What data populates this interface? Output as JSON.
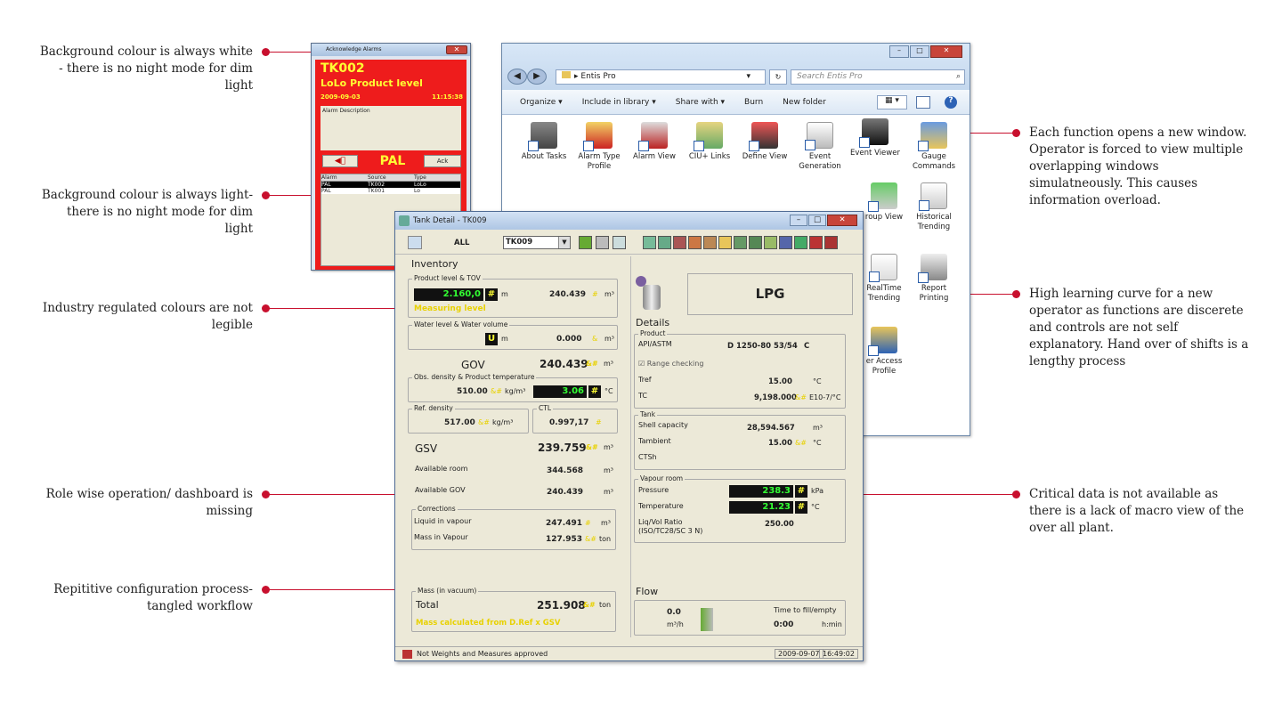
{
  "annotations_left": [
    "Background colour is always white - there is no night mode for dim light",
    "Background colour is always light- there is no night mode for dim light",
    "Industry regulated colours are not legible",
    "Role wise operation/ dashboard is missing",
    "Repititive configuration process- tangled workflow"
  ],
  "annotations_right": [
    "Each function opens a new window. Operator is forced to view multiple overlapping windows simulatneously. This causes information overload.",
    "High learning curve for a new operator as functions are discerete and controls are not self explanatory. Hand over of shifts is a lengthy process",
    "Critical data is not available as there is a lack of macro view of the over all plant."
  ],
  "accent_color": "#c8102e",
  "alarm": {
    "title": "Acknowledge Alarms",
    "tank": "TK002",
    "message": "LoLo Product level",
    "date": "2009-09-03",
    "time": "11:15:38",
    "desc_label": "Alarm Description",
    "pal": "PAL",
    "ack": "Ack",
    "columns": [
      "Alarm",
      "Source",
      "Type"
    ],
    "rows": [
      [
        "PAL",
        "TK002",
        "LoLo"
      ],
      [
        "PAL",
        "TK001",
        "Lo"
      ]
    ]
  },
  "explorer": {
    "path": "Entis Pro",
    "search_placeholder": "Search Entis Pro",
    "commands": [
      "Organize ▾",
      "Include in library ▾",
      "Share with ▾",
      "Burn",
      "New folder"
    ],
    "icons": [
      "About Tasks",
      "Alarm Type Profile",
      "Alarm View",
      "CIU+ Links",
      "Define View",
      "Event Generation",
      "Event Viewer",
      "Gauge Commands",
      "roup View",
      "Historical Trending",
      "RealTime Trending",
      "Report Printing",
      "er Access Profile"
    ]
  },
  "tank": {
    "title": "Tank Detail - TK009",
    "all": "ALL",
    "tank_select": "TK009",
    "inventory": "Inventory",
    "product_level_tov": "Product level & TOV",
    "product_level": "2.160,0",
    "unit_m": "m",
    "tov": "240.439",
    "unit_m3": "m³",
    "measuring": "Measuring level",
    "water_group": "Water level & Water volume",
    "water_flag": "U",
    "water_vol": "0.000",
    "gov_label": "GOV",
    "gov": "240.439",
    "amp": "&#",
    "obs_group": "Obs. density & Product temperature",
    "obs_density": "510.00",
    "unit_kgm3": "kg/m³",
    "prod_temp": "3.06",
    "unit_c": "°C",
    "ref_group": "Ref. density",
    "ref_density": "517.00",
    "ctl_group": "CTL",
    "ctl": "0.997,17",
    "gsv_label": "GSV",
    "gsv": "239.759",
    "avail_room_label": "Available room",
    "avail_room": "344.568",
    "avail_gov_label": "Available GOV",
    "avail_gov": "240.439",
    "corr_group": "Corrections",
    "liq_vap_label": "Liquid in vapour",
    "liq_vap": "247.491",
    "mass_vap_label": "Mass in Vapour",
    "mass_vap": "127.953",
    "unit_ton": "ton",
    "mass_group": "Mass (in vacuum)",
    "total_label": "Total",
    "total": "251.908",
    "mass_note": "Mass calculated from D.Ref x GSV",
    "product_name": "LPG",
    "details": "Details",
    "product_group": "Product",
    "api_label": "API/ASTM",
    "api": "D 1250-80 53/54",
    "api_c": "C",
    "range_check": "Range checking",
    "tref_label": "Tref",
    "tref": "15.00",
    "tc_label": "TC",
    "tc": "9,198.000",
    "tc_unit": "E10-7/°C",
    "tank_group": "Tank",
    "shell_label": "Shell capacity",
    "shell": "28,594.567",
    "tamb_label": "Tambient",
    "tamb": "15.00",
    "ctsh_label": "CTSh",
    "vapour_group": "Vapour room",
    "pressure_label": "Pressure",
    "pressure": "238.3",
    "unit_kpa": "kPa",
    "temp_label": "Temperature",
    "temp": "21.23",
    "liqvol_label": "Liq/Vol Ratio",
    "liqvol_sub": "(ISO/TC28/SC 3 N)",
    "liqvol": "250.00",
    "flow": "Flow",
    "flow_val": "0.0",
    "flow_unit": "m³/h",
    "fill_label": "Time to fill/empty",
    "fill_val": "0:00",
    "fill_unit": "h:min",
    "status": "Not Weights and Measures approved",
    "status_date": "2009-09-07",
    "status_time": "16:49:02"
  }
}
